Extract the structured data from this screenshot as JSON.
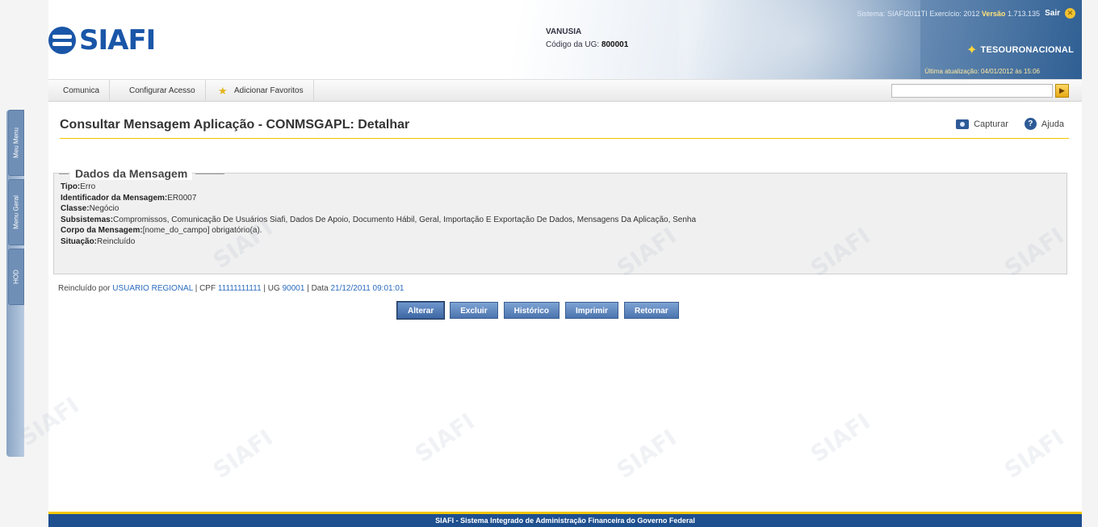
{
  "header": {
    "logo_text": "SIAFI",
    "user_name": "VANUSIA",
    "ug_label": "Código da UG:",
    "ug_value": "800001",
    "system_label": "Sistema:",
    "system_value": "SIAFI2011TI",
    "exercicio_label": "Exercício:",
    "exercicio_value": "2012",
    "versao_label": "Versão",
    "versao_value": "1.713.135",
    "sair_label": "Sair",
    "tesouro_label": "TESOURONACIONAL",
    "last_update_label": "Última atualização:",
    "last_update_value": "04/01/2012 às 15:06"
  },
  "nav": {
    "items": [
      {
        "label": "Comunica"
      },
      {
        "label": "Configurar Acesso"
      },
      {
        "label": "Adicionar Favoritos"
      }
    ],
    "search_placeholder": "",
    "go_label": "▶"
  },
  "sidebar": {
    "tabs": [
      {
        "label": "Meu Menu"
      },
      {
        "label": "Menu Geral"
      },
      {
        "label": "HOD"
      }
    ]
  },
  "page": {
    "title": "Consultar Mensagem Aplicação - CONMSGAPL: Detalhar",
    "tools": {
      "capture_label": "Capturar",
      "help_label": "Ajuda"
    }
  },
  "message": {
    "legend": "Dados da Mensagem",
    "fields": [
      {
        "key": "Tipo:",
        "value": "Erro"
      },
      {
        "key": "Identificador da Mensagem:",
        "value": "ER0007"
      },
      {
        "key": "Classe:",
        "value": "Negócio"
      },
      {
        "key": "Subsistemas:",
        "value": "Compromissos, Comunicação De Usuários Siafi, Dados De Apoio, Documento Hábil, Geral, Importação E Exportação De Dados, Mensagens Da Aplicação, Senha"
      },
      {
        "key": "Corpo da Mensagem:",
        "value": "[nome_do_campo] obrigatório(a)."
      },
      {
        "key": "Situação:",
        "value": "Reincluído"
      }
    ]
  },
  "audit": {
    "prefix": "Reincluído por",
    "user": "USUARIO REGIONAL",
    "cpf_label": "| CPF",
    "cpf": "11111111111",
    "ug_label": "| UG",
    "ug": "90001",
    "date_label": "| Data",
    "date": "21/12/2011 09:01:01"
  },
  "buttons": {
    "alterar": "Alterar",
    "excluir": "Excluir",
    "historico": "Histórico",
    "imprimir": "Imprimir",
    "retornar": "Retornar"
  },
  "footer": {
    "text": "SIAFI - Sistema Integrado de Administração Financeira do Governo Federal"
  },
  "colors": {
    "brand_blue": "#1a56a8",
    "accent_yellow": "#f3c700",
    "button_blue": "#4b74ae",
    "footer_blue": "#1e4f8f",
    "link_blue": "#2a6bbf"
  }
}
